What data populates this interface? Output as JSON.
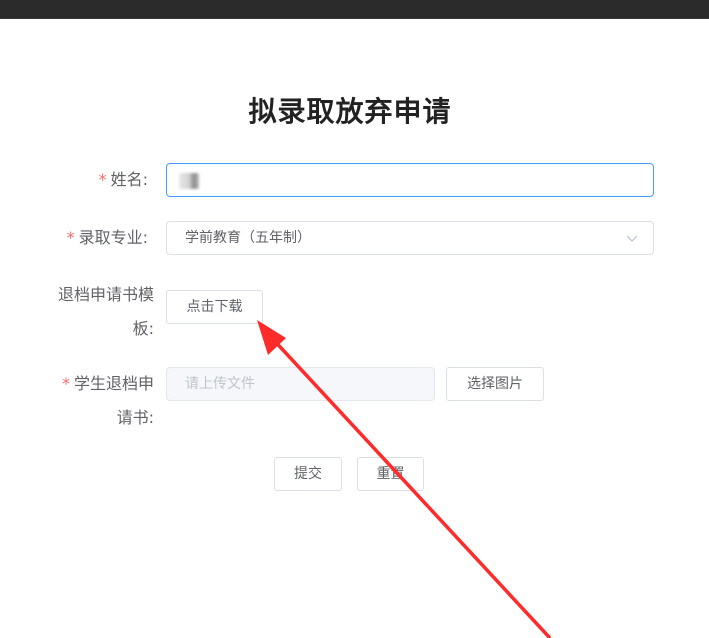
{
  "form": {
    "title": "拟录取放弃申请",
    "required_mark": "*",
    "name": {
      "label": "姓名:"
    },
    "major": {
      "label": "录取专业:",
      "selected": "学前教育（五年制）"
    },
    "template": {
      "label_line1": "退档申请书模",
      "label_line2": "板:",
      "download_label": "点击下载"
    },
    "upload": {
      "label_line1": "学生退档申",
      "label_line2": "请书:",
      "placeholder": "请上传文件",
      "choose_label": "选择图片"
    },
    "submit_label": "提交",
    "reset_label": "重置"
  },
  "colors": {
    "required": "#f56c6c",
    "focus_border": "#409eff",
    "annotation_arrow": "#ff2a2a"
  }
}
